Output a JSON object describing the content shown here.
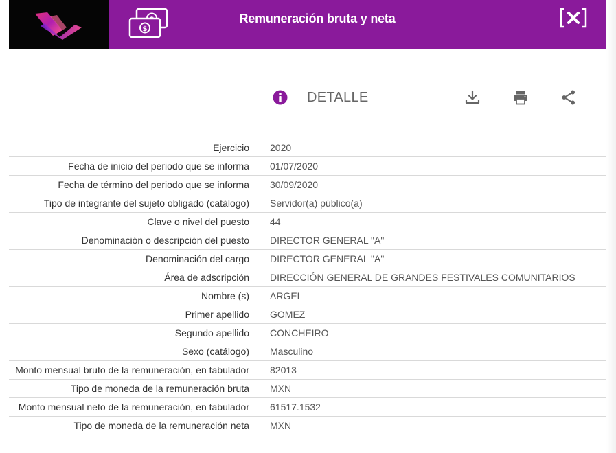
{
  "header": {
    "title": "Remuneración bruta y neta",
    "background_color": "#8a1a9b"
  },
  "toolbar": {
    "detail_label": "DETALLE",
    "accent_color": "#8a1a9b",
    "icons": [
      "info-icon",
      "download-icon",
      "print-icon",
      "share-icon"
    ]
  },
  "details": {
    "rows": [
      {
        "label": "Ejercicio",
        "value": "2020"
      },
      {
        "label": "Fecha de inicio del periodo que se informa",
        "value": "01/07/2020"
      },
      {
        "label": "Fecha de término del periodo que se informa",
        "value": "30/09/2020"
      },
      {
        "label": "Tipo de integrante del sujeto obligado (catálogo)",
        "value": "Servidor(a) público(a)"
      },
      {
        "label": "Clave o nivel del puesto",
        "value": "44"
      },
      {
        "label": "Denominación o descripción del puesto",
        "value": "DIRECTOR GENERAL \"A\""
      },
      {
        "label": "Denominación del cargo",
        "value": "DIRECTOR GENERAL \"A\""
      },
      {
        "label": "Área de adscripción",
        "value": "DIRECCIÓN GENERAL DE GRANDES FESTIVALES COMUNITARIOS"
      },
      {
        "label": "Nombre (s)",
        "value": "ARGEL"
      },
      {
        "label": "Primer apellido",
        "value": "GOMEZ"
      },
      {
        "label": "Segundo apellido",
        "value": "CONCHEIRO"
      },
      {
        "label": "Sexo (catálogo)",
        "value": "Masculino"
      },
      {
        "label": "Monto mensual bruto de la remuneración, en tabulador",
        "value": "82013"
      },
      {
        "label": "Tipo de moneda de la remuneración bruta",
        "value": "MXN"
      },
      {
        "label": "Monto mensual neto de la remuneración, en tabulador",
        "value": "61517.1532"
      },
      {
        "label": "Tipo de moneda de la remuneración neta",
        "value": "MXN"
      }
    ]
  }
}
